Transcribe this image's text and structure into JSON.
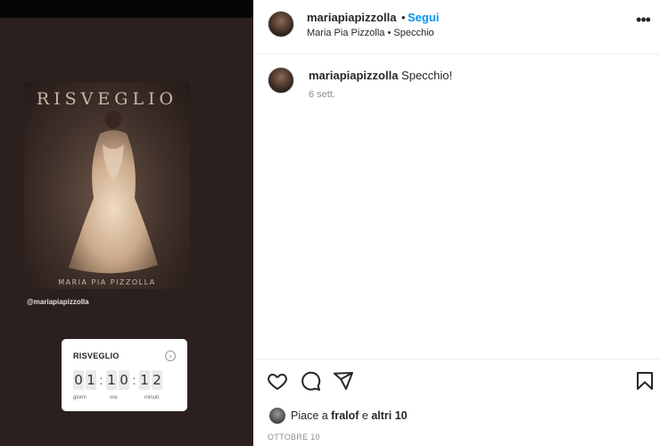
{
  "media": {
    "poster_title": "RISVEGLIO",
    "poster_artist": "MARIA PIA PIZZOLLA",
    "mention": "@mariapiapizzolla",
    "countdown": {
      "title": "RISVEGLIO",
      "digits": [
        "0",
        "1",
        "1",
        "0",
        "1",
        "2"
      ],
      "label_days": "giorni",
      "label_hours": "ore",
      "label_minutes": "minuti"
    }
  },
  "header": {
    "username": "mariapiapizzolla",
    "dot": "•",
    "follow_label": "Segui",
    "subtitle": "Maria Pia Pizzolla • Specchio",
    "more_label": "•••"
  },
  "caption": {
    "username": "mariapiapizzolla",
    "text": "Specchio!",
    "time": "6 sett."
  },
  "actions": {
    "likes_prefix": "Piace a ",
    "likes_user": "fralof",
    "likes_mid": " e ",
    "likes_others": "altri 10",
    "date": "OTTOBRE 10"
  },
  "icons": [
    "heart-icon",
    "comment-icon",
    "share-icon",
    "bookmark-icon",
    "more-icon",
    "countdown-arrow-icon"
  ]
}
